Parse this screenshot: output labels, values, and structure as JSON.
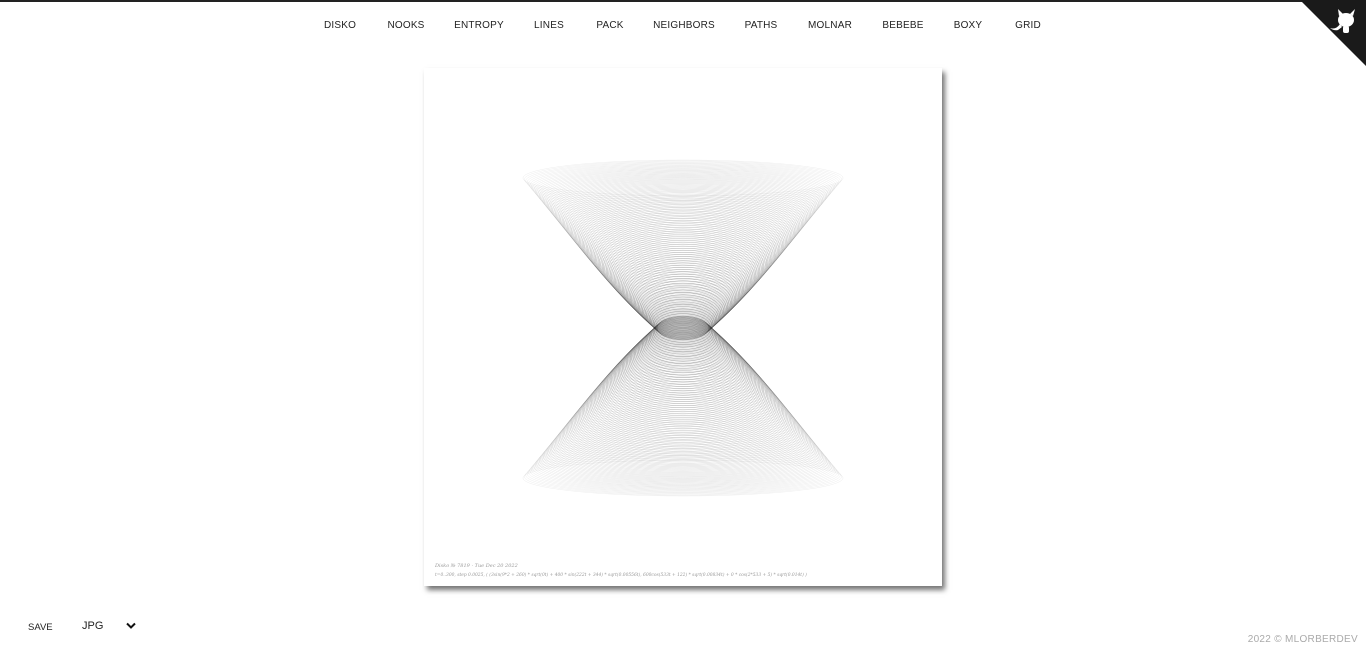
{
  "nav": {
    "items": [
      "DISKO",
      "NOOKS",
      "ENTROPY",
      "LINES",
      "PACK",
      "NEIGHBORS",
      "PATHS",
      "MOLNAR",
      "BEBEBE",
      "BOXY",
      "GRID"
    ]
  },
  "canvas": {
    "caption_line1": "Disko № 7819 · Tue Dec 20 2022",
    "caption_line2": "t=0..300, step 0.0025, ( (3sin(9*2 + 260) * sqrt(0t) + 400 * sin(222t + 344) * sqrt(0.00556t), 600cos(533t + 122) * sqrt(0.00834t) + 0 * cos(2*533 + 5) * sqrt(0.014t) )"
  },
  "controls": {
    "save_label": "SAVE",
    "format_value": "JPG"
  },
  "footer": {
    "text": "2022 © MLORBERDEV"
  },
  "colors": {
    "ink": "#000000",
    "accent_corner": "#1a1a1a",
    "footer_text": "#aaaaaa"
  },
  "icons": {
    "corner": "github-octocat-icon",
    "select": "chevron-down-icon"
  }
}
